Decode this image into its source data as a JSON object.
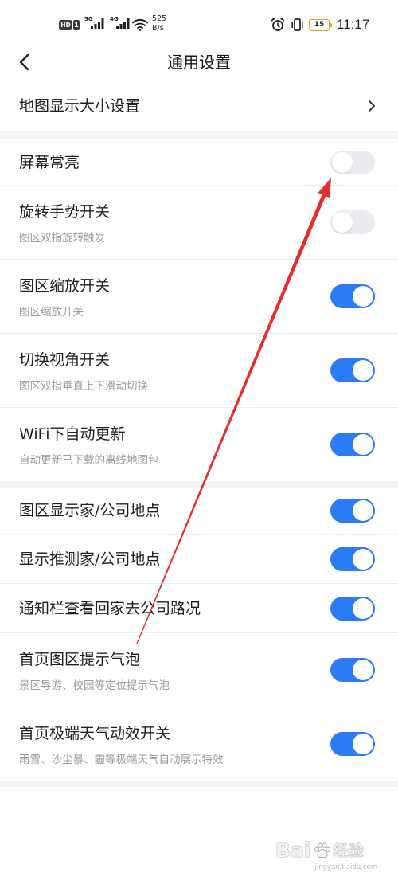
{
  "theme": {
    "accent": "#2a7bf4",
    "toggle_off": "#ececf0",
    "section_gap": "#f4f4f6",
    "annotation_arrow": "#e52d2d",
    "battery_outline": "#e6a11c"
  },
  "status_bar": {
    "hd_badge": "HD",
    "sim_badge": "1",
    "sim1_network": "5G",
    "sim2_network": "4G",
    "net_speed": "525",
    "net_speed_unit": "B/s",
    "battery_percent": "15",
    "time": "11:17",
    "icons": {
      "signal": "signal-bars-icon",
      "wifi": "wifi-icon",
      "alarm": "alarm-clock-icon",
      "vibrate": "vibrate-icon",
      "battery": "battery-icon"
    }
  },
  "header": {
    "back_icon": "chevron-left-icon",
    "title": "通用设置"
  },
  "sections": [
    {
      "items": [
        {
          "title": "地图显示大小设置",
          "trailing_icon": "chevron-right-icon"
        }
      ]
    },
    {
      "items": [
        {
          "title": "屏幕常亮",
          "on": false
        },
        {
          "title": "旋转手势开关",
          "subtitle": "图区双指旋转触发",
          "on": false
        },
        {
          "title": "图区缩放开关",
          "subtitle": "图区缩放开关",
          "on": true
        },
        {
          "title": "切换视角开关",
          "subtitle": "图区双指垂直上下滑动切换",
          "on": true
        },
        {
          "title": "WiFi下自动更新",
          "subtitle": "自动更新已下载的离线地图包",
          "on": true
        }
      ]
    },
    {
      "items": [
        {
          "title": "图区显示家/公司地点",
          "on": true
        },
        {
          "title": "显示推测家/公司地点",
          "on": true
        },
        {
          "title": "通知栏查看回家去公司路况",
          "on": true
        },
        {
          "title": "首页图区提示气泡",
          "subtitle": "景区导游、校园等定位提示气泡",
          "on": true
        },
        {
          "title": "首页极端天气动效开关",
          "subtitle": "雨雪、沙尘暴、霾等极端天气自动展示特效",
          "on": true
        }
      ]
    }
  ],
  "watermark": {
    "brand": "Bai",
    "logo_icon": "paw-icon",
    "brand_suffix": "经验",
    "url": "jingyan.baidu.com"
  }
}
